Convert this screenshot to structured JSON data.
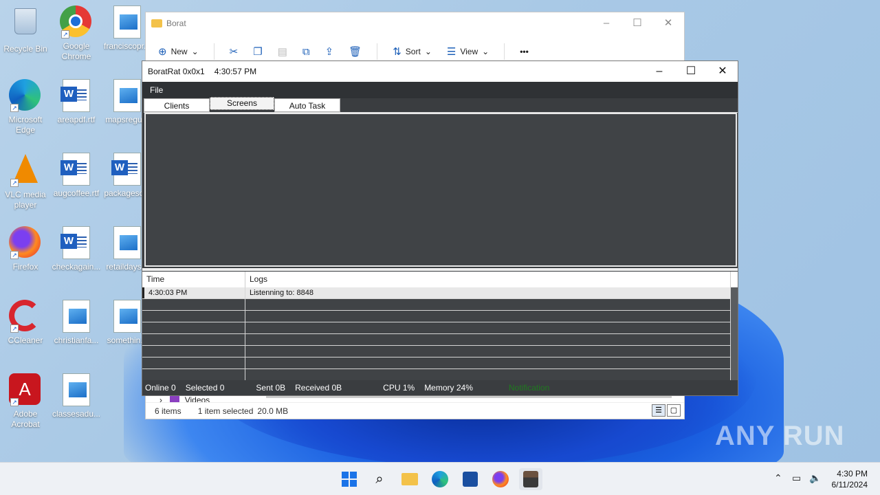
{
  "desktop": {
    "icons": [
      {
        "label": "Recycle Bin"
      },
      {
        "label": "Google Chrome"
      },
      {
        "label": "franciscopr..."
      },
      {
        "label": "Microsoft Edge"
      },
      {
        "label": "areapdf.rtf"
      },
      {
        "label": "mapsregu..."
      },
      {
        "label": "VLC media player"
      },
      {
        "label": "augcoffee.rtf"
      },
      {
        "label": "packagesc..."
      },
      {
        "label": "Firefox"
      },
      {
        "label": "checkagain..."
      },
      {
        "label": "retaildays..."
      },
      {
        "label": "CCleaner"
      },
      {
        "label": "christianfa..."
      },
      {
        "label": "somethin..."
      },
      {
        "label": "Adobe Acrobat"
      },
      {
        "label": "classesadu..."
      }
    ]
  },
  "explorer": {
    "title": "Borat",
    "toolbar": {
      "new": "New",
      "sort": "Sort",
      "view": "View",
      "more": "•••"
    },
    "tree_item": "Videos",
    "status": {
      "items": "6 items",
      "selected": "1 item selected",
      "size": "20.0 MB"
    }
  },
  "rat": {
    "title": "BoratRat 0x0x1",
    "time": "4:30:57 PM",
    "menu_file": "File",
    "tabs": [
      "Clients",
      "Screens",
      "Auto Task"
    ],
    "log_columns": {
      "time": "Time",
      "logs": "Logs"
    },
    "log_rows": [
      {
        "time": "4:30:03 PM",
        "log": "Listenning to: 8848"
      }
    ],
    "status": {
      "online": "Online 0",
      "selected": "Selected 0",
      "sent": "Sent 0B",
      "received": "Received  0B",
      "cpu": "CPU 1%",
      "memory": "Memory 24%",
      "notification": "Notification"
    }
  },
  "taskbar": {
    "clock_time": "4:30 PM",
    "clock_date": "6/11/2024"
  },
  "watermark": "ANY RUN"
}
